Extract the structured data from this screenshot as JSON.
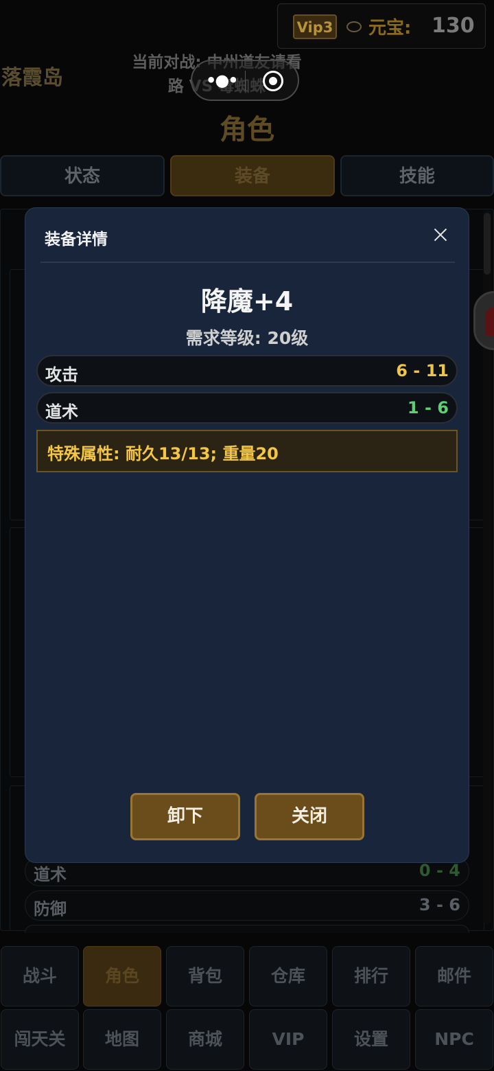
{
  "header": {
    "vip_label": "Vip3",
    "currency_icon": "ingot-icon",
    "currency_label": "元宝:",
    "currency_value": "130",
    "location": "落霞岛",
    "battle_line1": "当前对战: 中州道友请看",
    "battle_line2": "路 VS 毒蜘蛛",
    "capsule_icons": [
      "more-icon",
      "target-icon"
    ]
  },
  "page_title": "角色",
  "tabs": [
    {
      "label": "状态",
      "active": false
    },
    {
      "label": "装备",
      "active": true
    },
    {
      "label": "技能",
      "active": false
    }
  ],
  "background_stats": [
    {
      "name": "道术",
      "value": "0 - 4"
    },
    {
      "name": "防御",
      "value": "3 - 6"
    }
  ],
  "modal": {
    "header": "装备详情",
    "item_name": "降魔+4",
    "required_level": "需求等级: 20级",
    "attributes": [
      {
        "name": "攻击",
        "value": "6 - 11",
        "color": "#f0c445"
      },
      {
        "name": "道术",
        "value": "1 - 6",
        "color": "#5fcf73"
      }
    ],
    "special": "特殊属性: 耐久13/13; 重量20",
    "buttons": {
      "unequip": "卸下",
      "close": "关闭"
    }
  },
  "bottom_nav": {
    "row1": [
      "战斗",
      "角色",
      "背包",
      "仓库",
      "排行",
      "邮件"
    ],
    "row2": [
      "闯天关",
      "地图",
      "商城",
      "VIP",
      "设置",
      "NPC"
    ],
    "active": "角色"
  },
  "colors": {
    "modal_bg": "#18253a",
    "accent_gold": "#f3c646",
    "button_brown": "#6b4c1b"
  }
}
